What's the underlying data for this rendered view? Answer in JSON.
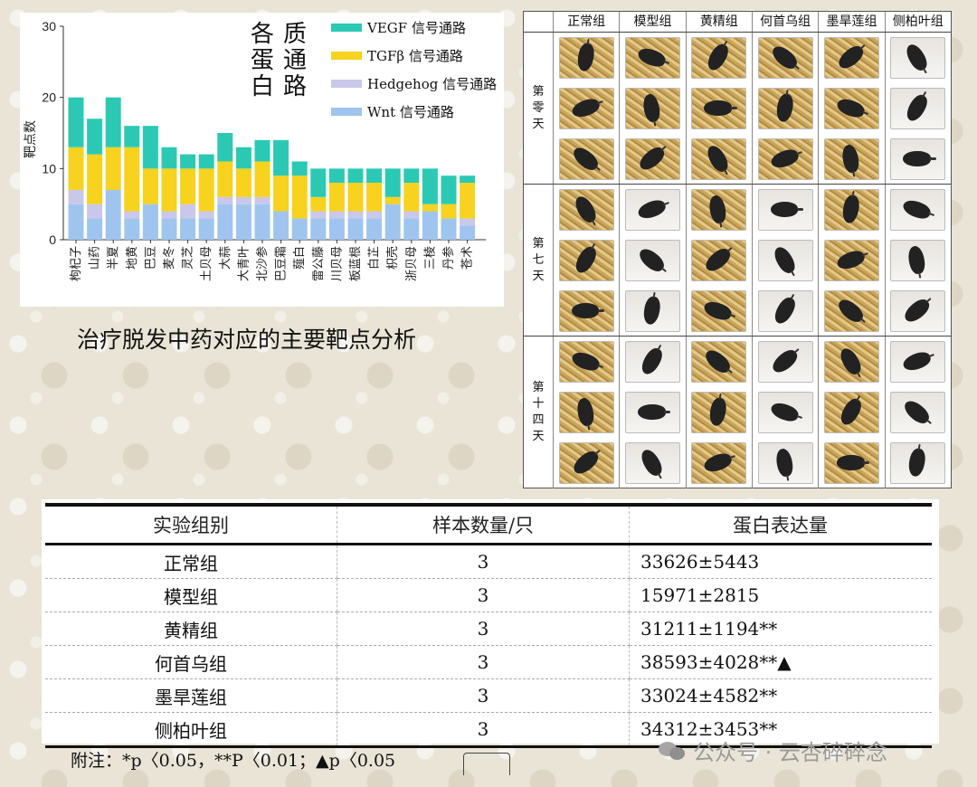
{
  "chart_data": {
    "type": "bar",
    "stacked": true,
    "title": "各蛋白质通路",
    "ylabel": "靶点数",
    "ylim": [
      0,
      30
    ],
    "yticks": [
      0,
      10,
      20,
      30
    ],
    "legend_position": "top-right",
    "categories": [
      "枸杞子",
      "山药",
      "半夏",
      "地黄",
      "巴豆",
      "麦冬",
      "灵芝",
      "土贝母",
      "大蒜",
      "大青叶",
      "北沙参",
      "巴豆霜",
      "薤白",
      "雷公藤",
      "川贝母",
      "板蓝根",
      "白芷",
      "枳壳",
      "浙贝母",
      "三棱",
      "丹参",
      "苍术"
    ],
    "series": [
      {
        "name": "Wnt 信号通路",
        "color": "#9fc5ee",
        "values": [
          5,
          3,
          7,
          3,
          5,
          3,
          3,
          3,
          5,
          5,
          5,
          4,
          3,
          3,
          3,
          3,
          3,
          5,
          3,
          4,
          3,
          2
        ]
      },
      {
        "name": "Hedgehog 信号通路",
        "color": "#c9c8ea",
        "values": [
          2,
          2,
          0,
          1,
          0,
          1,
          2,
          1,
          1,
          1,
          1,
          0,
          0,
          1,
          1,
          1,
          1,
          0,
          1,
          0,
          0,
          1
        ]
      },
      {
        "name": "TGFβ 信号通路",
        "color": "#f7d21e",
        "values": [
          6,
          7,
          6,
          9,
          5,
          6,
          5,
          6,
          5,
          4,
          5,
          5,
          6,
          2,
          4,
          4,
          4,
          1,
          4,
          1,
          2,
          5
        ]
      },
      {
        "name": "VEGF 信号通路",
        "color": "#2bc9b4",
        "values": [
          7,
          5,
          7,
          3,
          6,
          3,
          2,
          2,
          4,
          3,
          3,
          5,
          2,
          4,
          2,
          2,
          2,
          4,
          2,
          5,
          4,
          1
        ]
      }
    ]
  },
  "caption": "治疗脱发中药对应的主要靶点分析",
  "photo_grid": {
    "columns": [
      "正常组",
      "模型组",
      "黄精组",
      "何首乌组",
      "墨旱莲组",
      "侧柏叶组"
    ],
    "days": [
      {
        "label": "第零天",
        "chars": [
          "第",
          "零",
          "天"
        ]
      },
      {
        "label": "第七天",
        "chars": [
          "第",
          "七",
          "天"
        ]
      },
      {
        "label": "第十四天",
        "chars": [
          "第",
          "十",
          "四",
          "天"
        ]
      }
    ]
  },
  "table": {
    "headers": [
      "实验组别",
      "样本数量/只",
      "蛋白表达量"
    ],
    "rows": [
      [
        "正常组",
        "3",
        "33626±5443"
      ],
      [
        "模型组",
        "3",
        "15971±2815"
      ],
      [
        "黄精组",
        "3",
        "31211±1194**"
      ],
      [
        "何首乌组",
        "3",
        "38593±4028**▲"
      ],
      [
        "墨旱莲组",
        "3",
        "33024±4582**"
      ],
      [
        "侧柏叶组",
        "3",
        "34312±3453**"
      ]
    ],
    "note": "附注：*p〈0.05，**P〈0.01；▲p〈0.05"
  },
  "watermark": "公众号 · 云杏碎碎念"
}
